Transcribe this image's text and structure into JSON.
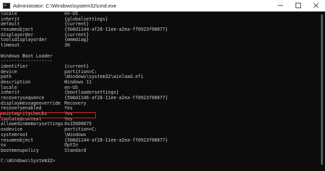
{
  "window": {
    "title": "Administrator: C:\\Windows\\system32\\cmd.exe"
  },
  "console": {
    "lines": [
      {
        "key": "locale",
        "value": "en-US"
      },
      {
        "key": "inherit",
        "value": "{globalsettings}"
      },
      {
        "key": "default",
        "value": "{current}"
      },
      {
        "key": "resumeobject",
        "value": "{5b6d1144-af28-11ee-a2ea-ff0923f98877}"
      },
      {
        "key": "displayorder",
        "value": "{current}"
      },
      {
        "key": "toolsdisplayorder",
        "value": "{memdiag}"
      },
      {
        "key": "timeout",
        "value": "30"
      },
      {
        "text": ""
      },
      {
        "text": "Windows Boot Loader"
      },
      {
        "text": "-------------------"
      },
      {
        "key": "identifier",
        "value": "{current}"
      },
      {
        "key": "device",
        "value": "partition=C:"
      },
      {
        "key": "path",
        "value": "\\Windows\\system32\\winload.efi"
      },
      {
        "key": "description",
        "value": "Windows 11"
      },
      {
        "key": "locale",
        "value": "en-US"
      },
      {
        "key": "inherit",
        "value": "{bootloadersettings}"
      },
      {
        "key": "recoverysequence",
        "value": "{5b6d1146-af28-11ee-a2ea-ff0923f98877}"
      },
      {
        "key": "displaymessageoverride",
        "value": "Recovery"
      },
      {
        "key": "recoveryenabled",
        "value": "Yes"
      },
      {
        "key": "nointegritychecks",
        "value": "Yes"
      },
      {
        "key": "isolatedcontext",
        "value": "Yes"
      },
      {
        "key": "allowedinmemorysettings",
        "value": "0x15000075"
      },
      {
        "key": "osdevice",
        "value": "partition=C:"
      },
      {
        "key": "systemroot",
        "value": "\\Windows"
      },
      {
        "key": "resumeobject",
        "value": "{5b6d1144-af28-11ee-a2ea-ff0923f98877}"
      },
      {
        "key": "nx",
        "value": "OptIn"
      },
      {
        "key": "bootmenupolicy",
        "value": "Standard"
      },
      {
        "text": ""
      },
      {
        "text": "C:\\Windows\\System32>"
      }
    ]
  },
  "colors": {
    "background": "#0c0c0c",
    "text": "#cccccc",
    "highlight": "#d6262b"
  },
  "icons": {
    "app": "cmd-icon",
    "minimize": "minimize-icon",
    "maximize": "maximize-icon",
    "close": "close-icon"
  }
}
